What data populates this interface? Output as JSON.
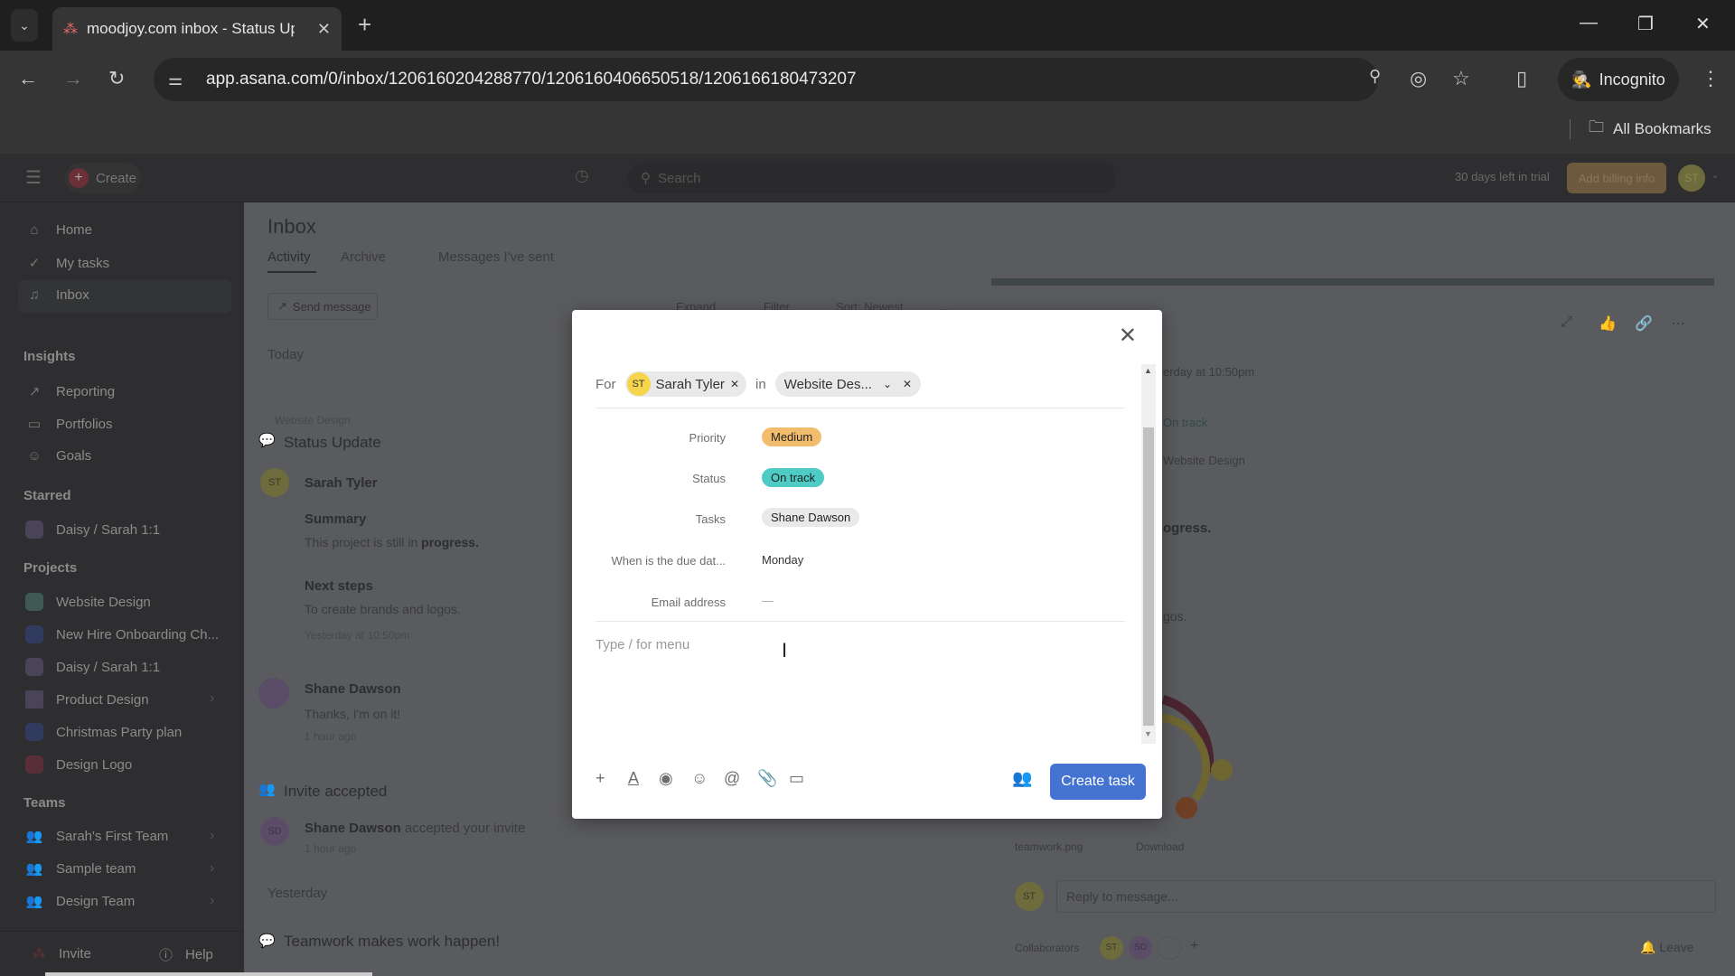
{
  "browser": {
    "tab_title": "moodjoy.com inbox - Status Up",
    "url": "app.asana.com/0/inbox/1206160204288770/1206160406650518/1206166180473207",
    "incognito_label": "Incognito",
    "bookmarks_label": "All Bookmarks",
    "icons": {
      "tab_list": "⌄",
      "new_tab": "+",
      "back": "←",
      "forward": "→",
      "reload": "↻",
      "zoom": "🔍",
      "eye_off": "◎",
      "star": "☆",
      "sidepanel": "▯",
      "menu": "⋮",
      "minimize": "—",
      "restore": "❐",
      "close": "✕"
    }
  },
  "topbar": {
    "create_label": "Create",
    "search_placeholder": "Search",
    "trial_text": "30 days left in trial",
    "billing_label": "Add billing info",
    "avatar": "ST"
  },
  "sidebar": {
    "nav": [
      {
        "label": "Home",
        "icon": "⌂"
      },
      {
        "label": "My tasks",
        "icon": "✓"
      },
      {
        "label": "Inbox",
        "icon": "🔔"
      }
    ],
    "insights_heading": "Insights",
    "insights": [
      {
        "label": "Reporting",
        "icon": "↗"
      },
      {
        "label": "Portfolios",
        "icon": "▭"
      },
      {
        "label": "Goals",
        "icon": "☺"
      }
    ],
    "starred_heading": "Starred",
    "starred": [
      {
        "label": "Daisy / Sarah 1:1",
        "color": "#4a4458"
      }
    ],
    "projects_heading": "Projects",
    "projects": [
      {
        "label": "Website Design",
        "color": "#3f5a55"
      },
      {
        "label": "New Hire Onboarding Ch...",
        "color": "#2f3a5e"
      },
      {
        "label": "Daisy / Sarah 1:1",
        "color": "#4a4458"
      },
      {
        "label": "Product Design",
        "color": "#4a4458"
      },
      {
        "label": "Christmas Party plan",
        "color": "#2f3a5e"
      },
      {
        "label": "Design Logo",
        "color": "#5a2e38"
      }
    ],
    "teams_heading": "Teams",
    "teams": [
      {
        "label": "Sarah's First Team"
      },
      {
        "label": "Sample team"
      },
      {
        "label": "Design Team"
      }
    ],
    "invite_label": "Invite",
    "help_label": "Help"
  },
  "inbox": {
    "title": "Inbox",
    "tabs": [
      {
        "label": "Activity",
        "active": true
      },
      {
        "label": "Archive"
      },
      {
        "label": "Messages I've sent"
      }
    ],
    "send_message": "Send message",
    "actions": [
      "Expand",
      "Filter",
      "Sort: Newest",
      "..."
    ],
    "today": "Today",
    "item1": {
      "project": "Website Design",
      "title": "Status Update",
      "author": "Sarah Tyler",
      "author_initials": "ST",
      "summary_h": "Summary",
      "summary_text": "This project is still in ",
      "summary_bold": "progress.",
      "next_h": "Next steps",
      "next_text": "To create brands and logos.",
      "time": "Yesterday at 10:50pm",
      "reply_author": "Shane Dawson",
      "reply_text": "Thanks, I'm on it!",
      "reply_time": "1 hour ago"
    },
    "item2": {
      "title": "Invite accepted",
      "author": "Shane Dawson",
      "text": "accepted your invite",
      "initials": "SD",
      "time": "1 hour ago"
    },
    "yesterday": "Yesterday",
    "item3_title": "Teamwork makes work happen!"
  },
  "detail": {
    "time_partial": "erday at 10:50pm",
    "status_partial": "On track",
    "project_partial": "Website Design",
    "progress_partial": "ogress.",
    "logos_partial": "gos.",
    "attachment_name": "teamwork.png",
    "download_label": "Download",
    "reply_placeholder": "Reply to message...",
    "collaborators_label": "Collaborators",
    "collab_initials": [
      "ST",
      "SD"
    ],
    "leave_label": "Leave"
  },
  "modal": {
    "for_label": "For",
    "assignee_initials": "ST",
    "assignee": "Sarah Tyler",
    "in_label": "in",
    "project": "Website Des...",
    "fields": [
      {
        "label": "Priority",
        "value": "Medium",
        "type": "tag",
        "color": "#f1bd6c"
      },
      {
        "label": "Status",
        "value": "On track",
        "type": "tag",
        "color": "#4ecbc4"
      },
      {
        "label": "Tasks",
        "value": "Shane Dawson",
        "type": "chip",
        "color": "#e9e9ea"
      },
      {
        "label": "When is the due dat...",
        "value": "Monday",
        "type": "text"
      },
      {
        "label": "Email address",
        "value": "—",
        "type": "text"
      }
    ],
    "description_placeholder": "Type / for menu",
    "create_label": "Create task",
    "toolbar_icons": [
      "+",
      "A",
      "◉",
      "☺",
      "@",
      "⌇",
      "▭"
    ]
  }
}
